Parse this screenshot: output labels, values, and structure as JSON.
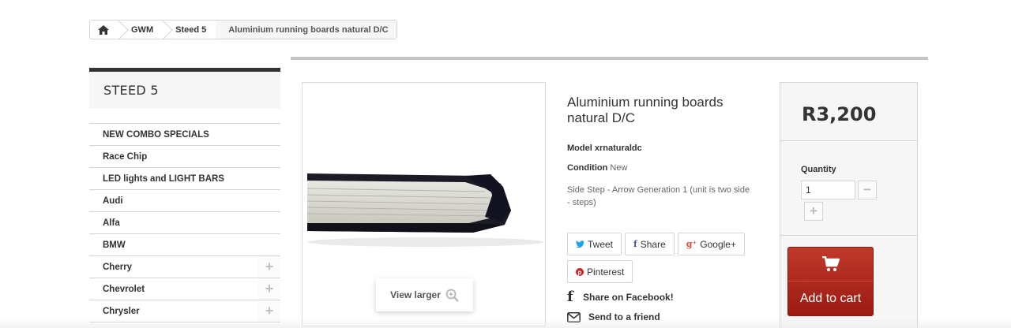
{
  "breadcrumb": {
    "home_icon": "home-icon",
    "items": [
      "GWM",
      "Steed 5"
    ],
    "current": "Aluminium running boards natural D/C"
  },
  "sidebar": {
    "title": "STEED 5",
    "categories": [
      {
        "label": "NEW COMBO SPECIALS",
        "expandable": false
      },
      {
        "label": "Race Chip",
        "expandable": false
      },
      {
        "label": "LED lights and LIGHT BARS",
        "expandable": false
      },
      {
        "label": "Audi",
        "expandable": false
      },
      {
        "label": "Alfa",
        "expandable": false
      },
      {
        "label": "BMW",
        "expandable": false
      },
      {
        "label": "Cherry",
        "expandable": true
      },
      {
        "label": "Chevrolet",
        "expandable": true
      },
      {
        "label": "Chrysler",
        "expandable": true
      }
    ]
  },
  "image": {
    "view_larger": "View larger",
    "zoom_icon": "zoom-in-icon"
  },
  "product": {
    "title": "Aluminium running boards natural D/C",
    "model_label": "Model",
    "model_value": "xrnaturaldc",
    "condition_label": "Condition",
    "condition_value": "New",
    "description": "Side Step - Arrow Generation 1 (unit is two side - steps)"
  },
  "share": {
    "tweet": "Tweet",
    "share": "Share",
    "google": "Google+",
    "pinterest": "Pinterest",
    "facebook_link": "Share on Facebook!",
    "friend_link": "Send to a friend"
  },
  "buy": {
    "price": "R3,200",
    "quantity_label": "Quantity",
    "quantity_value": "1",
    "minus": "−",
    "plus": "+",
    "add_to_cart": "Add to cart"
  },
  "colors": {
    "accent_red": "#b0271c",
    "twitter": "#1da1f2",
    "facebook": "#3b5998",
    "google": "#dd4b39",
    "pinterest": "#cb2027"
  }
}
